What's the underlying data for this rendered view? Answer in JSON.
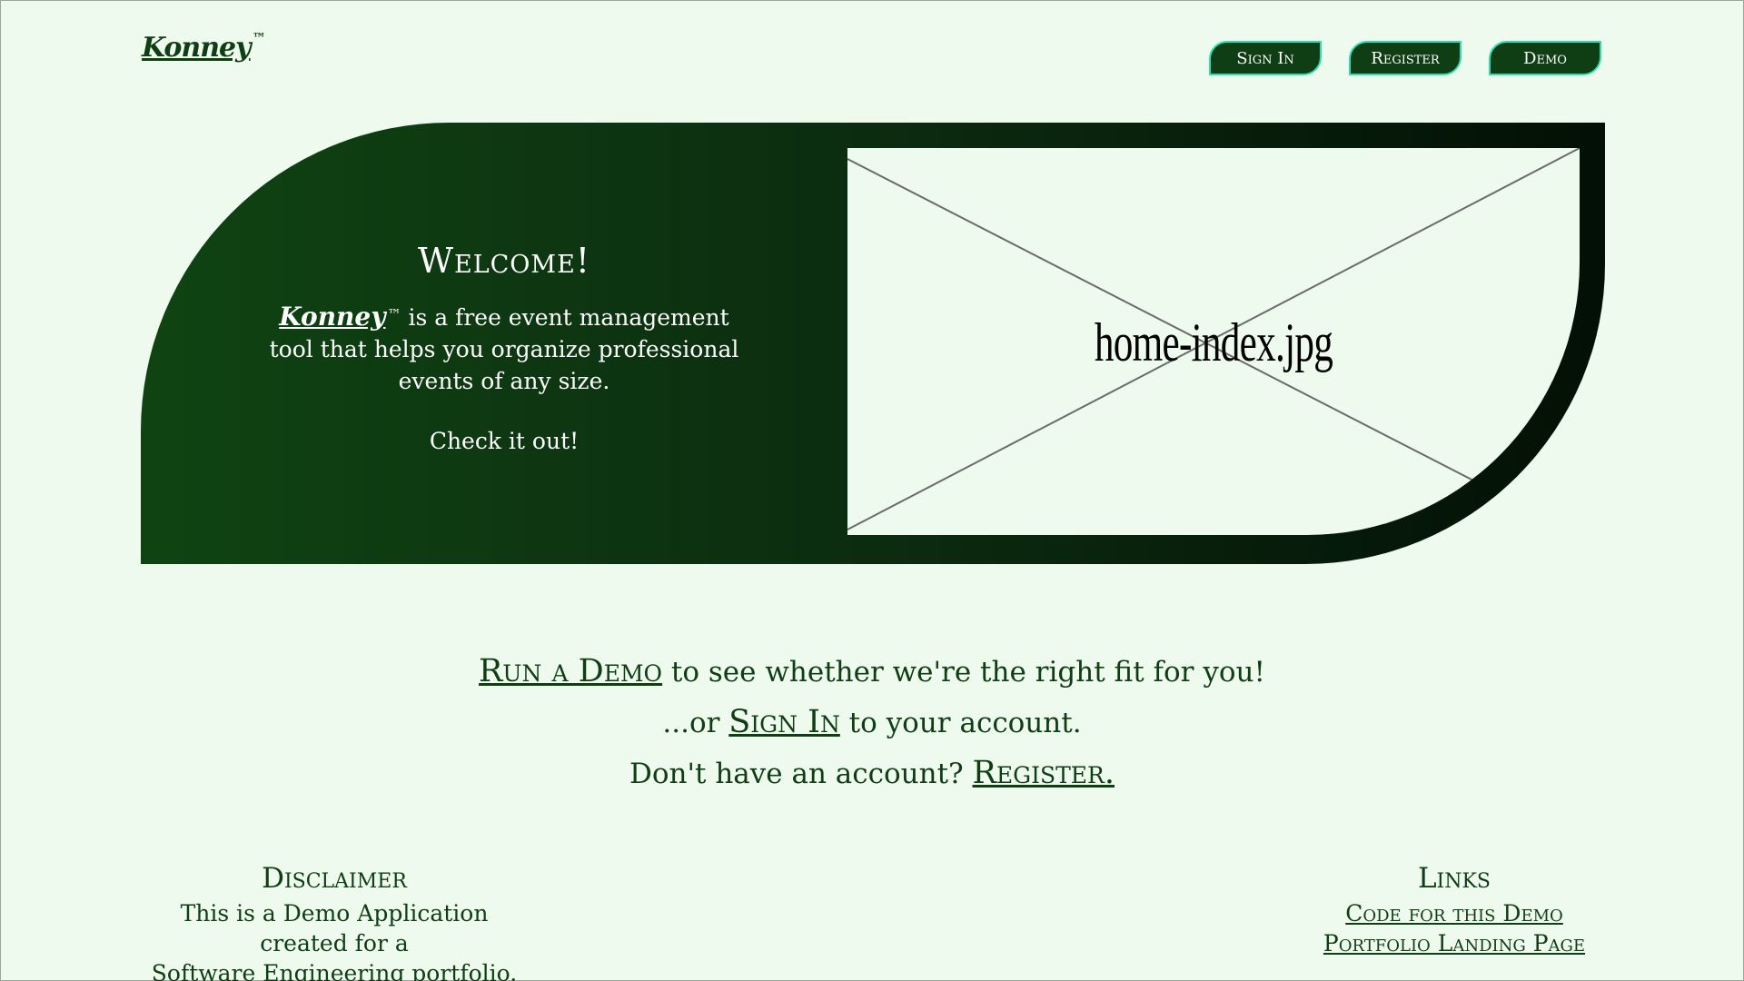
{
  "header": {
    "logo": "Konney",
    "logo_tm": "™",
    "nav": [
      "Sign In",
      "Register",
      "Demo"
    ]
  },
  "hero": {
    "title": "Welcome!",
    "brand": "Konney",
    "brand_tm": "™",
    "description": " is a free event management tool that helps you organize professional events of any size.",
    "cta": "Check it out!",
    "image_alt": "home-index.jpg"
  },
  "cta": {
    "line1_link": "Run a Demo",
    "line1_text": " to see whether we're the right fit for you!",
    "line2_prefix": "...or ",
    "line2_link": "Sign In",
    "line2_text": " to your account.",
    "line3_prefix": "Don't have an account? ",
    "line3_link": "Register."
  },
  "footer": {
    "disclaimer_title": "Disclaimer",
    "disclaimer_line1": "This is a Demo Application created for a",
    "disclaimer_line2": "Software Engineering portfolio.",
    "links_title": "Links",
    "links": [
      "Code for this Demo",
      "Portfolio Landing Page"
    ]
  },
  "colors": {
    "background": "#eefaee",
    "brand_green": "#0f3d14",
    "button_border": "#2ce0b0"
  }
}
